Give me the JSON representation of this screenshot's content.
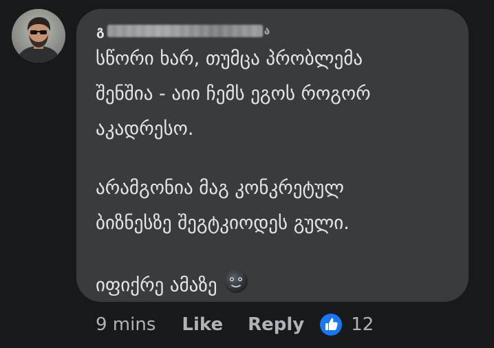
{
  "comment": {
    "author_visible": "გ",
    "author_tail": "ა",
    "text_lines": [
      "სწორი ხარ, თუმცა პრობლემა",
      "შენშია - აიი ჩემს ეგოს როგორ",
      "აკადრესო.",
      "არამგონია მაგ კონკრეტულ",
      "ბიზნესზე შეგტკიოდეს გული.",
      "იფიქრე ამაზე"
    ],
    "emoji_icon": "new-moon-face-emoji"
  },
  "meta": {
    "time": "9 mins",
    "like_label": "Like",
    "reply_label": "Reply",
    "reaction_icon": "like-reaction-icon",
    "reaction_count": "12"
  },
  "colors": {
    "background": "#18191a",
    "bubble": "#3a3b3c",
    "text": "#e4e6eb",
    "meta_text": "#b0b3b8",
    "like_blue": "#1877f2"
  }
}
